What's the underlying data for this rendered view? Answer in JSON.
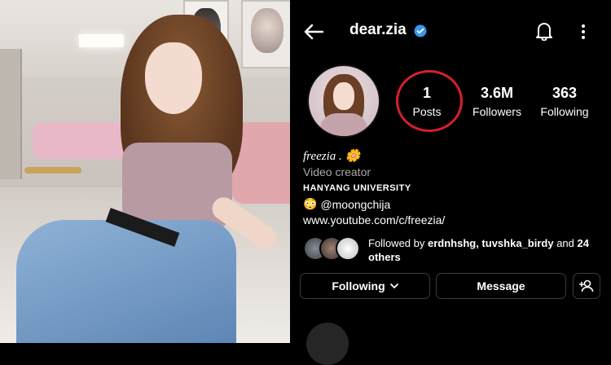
{
  "profile": {
    "username": "dear.zia",
    "verified_color": "#3897f0",
    "stats": {
      "posts": {
        "value": "1",
        "label": "Posts"
      },
      "followers": {
        "value": "3.6M",
        "label": "Followers"
      },
      "following": {
        "value": "363",
        "label": "Following"
      }
    },
    "highlight_color": "#d62028",
    "bio": {
      "name": "freezia .",
      "name_emoji": "🌼",
      "category": "Video creator",
      "university": "HANYANG UNIVERSITY",
      "mention_emoji": "😳",
      "mention": "@moongchija",
      "link": "www.youtube.com/c/freezia/"
    },
    "followed_by": {
      "prefix": "Followed by ",
      "names": "erdnhshg, tuvshka_birdy",
      "middle": " and ",
      "others": "24 others"
    },
    "buttons": {
      "following": "Following",
      "message": "Message"
    }
  },
  "icons": {
    "back": "back-arrow-icon",
    "bell": "bell-icon",
    "more": "more-vertical-icon",
    "chevron": "chevron-down-icon",
    "add_user": "add-user-icon",
    "verified": "verified-badge-icon"
  }
}
